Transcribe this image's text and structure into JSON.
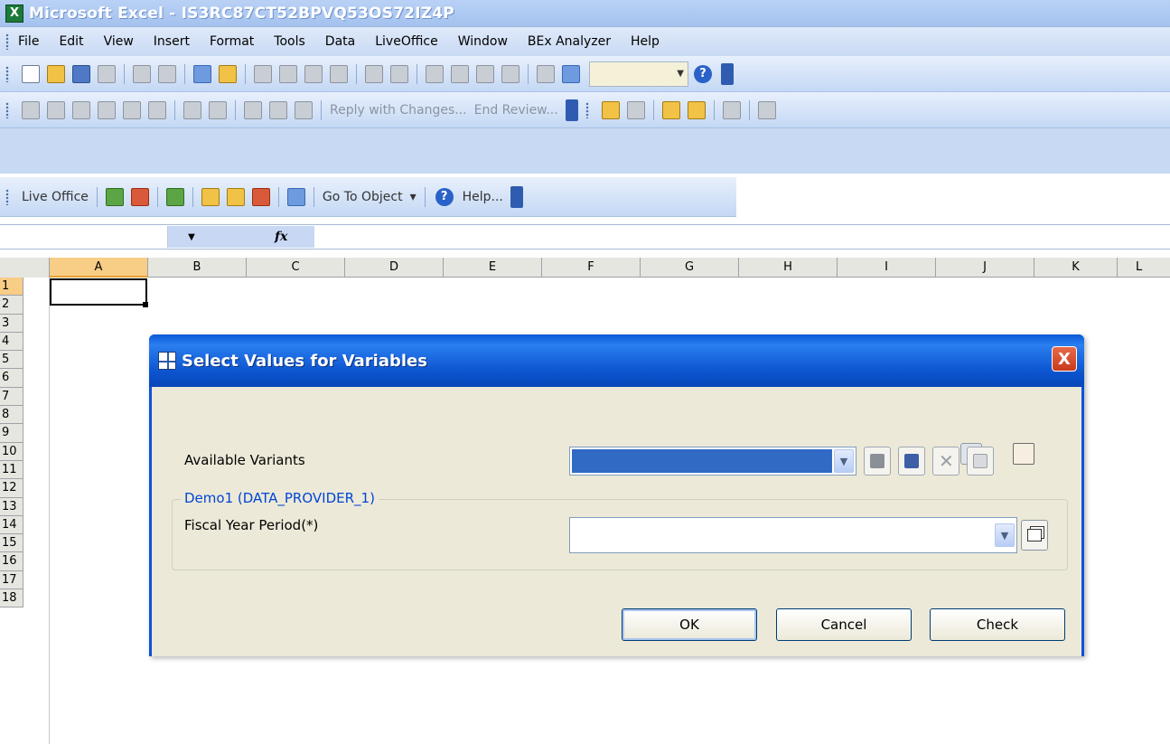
{
  "window": {
    "title": "Microsoft Excel - IS3RC87CT52BPVQ53OS72IZ4P",
    "app_icon": "excel-icon"
  },
  "menu": [
    "File",
    "Edit",
    "View",
    "Insert",
    "Format",
    "Tools",
    "Data",
    "LiveOffice",
    "Window",
    "BEx Analyzer",
    "Help"
  ],
  "review_toolbar": {
    "reply_label": "Reply with Changes...",
    "end_review_label": "End Review..."
  },
  "liveoffice_toolbar": {
    "label": "Live Office",
    "go_to_object": "Go To Object",
    "help": "Help..."
  },
  "formula_bar": {
    "name_box": "",
    "fx": "fx",
    "formula": ""
  },
  "grid": {
    "columns": [
      "A",
      "B",
      "C",
      "D",
      "E",
      "F",
      "G",
      "H",
      "I",
      "J",
      "K",
      "L"
    ],
    "rows": [
      "1",
      "2",
      "3",
      "4",
      "5",
      "6",
      "7",
      "8",
      "9",
      "10",
      "11",
      "12",
      "13",
      "14",
      "15",
      "16",
      "17",
      "18"
    ],
    "active_column": "A",
    "active_row": "1"
  },
  "dialog": {
    "title": "Select Values for Variables",
    "close_label": "X",
    "available_variants_label": "Available Variants",
    "group_label": "Demo1 (DATA_PROVIDER_1)",
    "fiscal_year_label": "Fiscal Year Period(*)",
    "ok_label": "OK",
    "cancel_label": "Cancel",
    "check_label": "Check"
  },
  "colors": {
    "dialog_title_blue": "#0c55d0",
    "group_label_blue": "#0046d5",
    "selection_blue": "#316ac5",
    "close_red": "#d5502f"
  }
}
